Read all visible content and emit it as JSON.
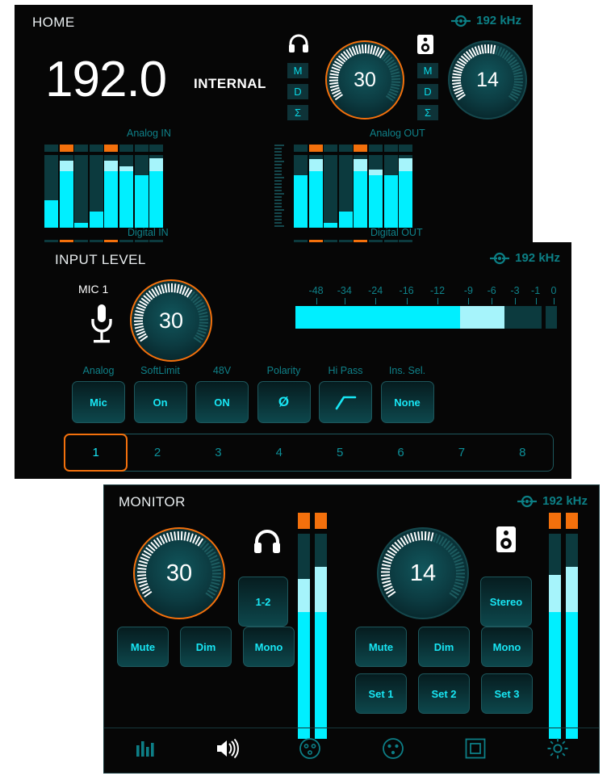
{
  "theme": {
    "bg": "#060606",
    "cyan": "#00efff",
    "cyan_light": "#a6f4fb",
    "teal_dark": "#0c3a3e",
    "teal_label": "#0f8189",
    "orange": "#f3700c",
    "white": "#ffffff"
  },
  "home": {
    "title": "HOME",
    "clock_rate": "192 kHz",
    "clock_icon": "wordclock-icon",
    "sample_rate": "192.0",
    "clock_source": "INTERNAL",
    "headphone": {
      "icon": "headphones-icon",
      "value": "30",
      "buttons": [
        "M",
        "D",
        "Σ"
      ]
    },
    "speaker": {
      "icon": "speaker-icon",
      "value": "14",
      "buttons": [
        "M",
        "D",
        "Σ"
      ]
    },
    "meters": {
      "label_analog_in": "Analog IN",
      "label_analog_out": "Analog OUT",
      "label_digital_in": "Digital IN",
      "label_digital_out": "Digital OUT",
      "input": [
        {
          "level": 38,
          "peak": 0,
          "clip": false
        },
        {
          "level": 78,
          "peak": 92,
          "clip": true
        },
        {
          "level": 7,
          "peak": 0,
          "clip": false
        },
        {
          "level": 22,
          "peak": 0,
          "clip": false
        },
        {
          "level": 78,
          "peak": 92,
          "clip": true
        },
        {
          "level": 78,
          "peak": 85,
          "clip": false
        },
        {
          "level": 72,
          "peak": 0,
          "clip": false
        },
        {
          "level": 78,
          "peak": 96,
          "clip": false
        }
      ],
      "output": [
        {
          "level": 72,
          "peak": 0,
          "clip": false
        },
        {
          "level": 78,
          "peak": 94,
          "clip": true
        },
        {
          "level": 7,
          "peak": 0,
          "clip": false
        },
        {
          "level": 22,
          "peak": 0,
          "clip": false
        },
        {
          "level": 78,
          "peak": 94,
          "clip": true
        },
        {
          "level": 72,
          "peak": 80,
          "clip": false
        },
        {
          "level": 72,
          "peak": 0,
          "clip": false
        },
        {
          "level": 78,
          "peak": 96,
          "clip": false
        }
      ],
      "digital_in_clip": [
        false,
        true,
        false,
        false,
        true,
        false,
        false,
        false
      ],
      "digital_out_clip": [
        false,
        true,
        false,
        false,
        true,
        false,
        false,
        false
      ]
    }
  },
  "input_level": {
    "title": "INPUT LEVEL",
    "clock_rate": "192 kHz",
    "clock_icon": "wordclock-icon",
    "channel_label": "MIC 1",
    "channel_icon": "microphone-icon",
    "gain_value": "30",
    "scale": {
      "ticks": [
        "-48",
        "-34",
        "-24",
        "-16",
        "-12",
        "-9",
        "-6",
        "-3",
        "-1",
        "0"
      ],
      "positions": [
        8,
        19,
        31,
        43,
        55,
        67,
        76,
        85,
        93,
        100
      ],
      "level_pct": 67,
      "peak_pct": 85
    },
    "controls": [
      {
        "label": "Analog",
        "value": "Mic",
        "name": "analog-input-type"
      },
      {
        "label": "SoftLimit",
        "value": "On",
        "name": "soft-limit"
      },
      {
        "label": "48V",
        "value": "ON",
        "name": "phantom-power"
      },
      {
        "label": "Polarity",
        "value": "Ø",
        "name": "polarity"
      },
      {
        "label": "Hi Pass",
        "value": "",
        "name": "high-pass",
        "icon": "highpass-slope-icon"
      },
      {
        "label": "Ins. Sel.",
        "value": "None",
        "name": "insert-select"
      }
    ],
    "channels": [
      "1",
      "2",
      "3",
      "4",
      "5",
      "6",
      "7",
      "8"
    ],
    "active_channel": "1"
  },
  "monitor": {
    "title": "MONITOR",
    "clock_rate": "192 kHz",
    "clock_icon": "wordclock-icon",
    "headphone": {
      "icon": "headphones-icon",
      "value": "30",
      "selected": true,
      "source_button": "1-2",
      "buttons": [
        "Mute",
        "Dim",
        "Mono"
      ],
      "meters": [
        {
          "level": 62,
          "peak": 78,
          "clip": true
        },
        {
          "level": 62,
          "peak": 84,
          "clip": true
        }
      ]
    },
    "speaker": {
      "icon": "speaker-icon",
      "value": "14",
      "selected": false,
      "source_button": "Stereo",
      "buttons": [
        "Mute",
        "Dim",
        "Mono"
      ],
      "sets": [
        "Set 1",
        "Set 2",
        "Set 3"
      ],
      "meters": [
        {
          "level": 62,
          "peak": 80,
          "clip": true
        },
        {
          "level": 62,
          "peak": 84,
          "clip": true
        }
      ]
    },
    "nav": [
      {
        "name": "nav-meters",
        "icon": "level-meters-icon",
        "active": false
      },
      {
        "name": "nav-monitor",
        "icon": "speaker-volume-icon",
        "active": true
      },
      {
        "name": "nav-input",
        "icon": "xlr-female-icon",
        "active": false
      },
      {
        "name": "nav-output",
        "icon": "xlr-male-icon",
        "active": false
      },
      {
        "name": "nav-display",
        "icon": "square-frame-icon",
        "active": false
      },
      {
        "name": "nav-settings",
        "icon": "gear-icon",
        "active": false
      }
    ]
  }
}
